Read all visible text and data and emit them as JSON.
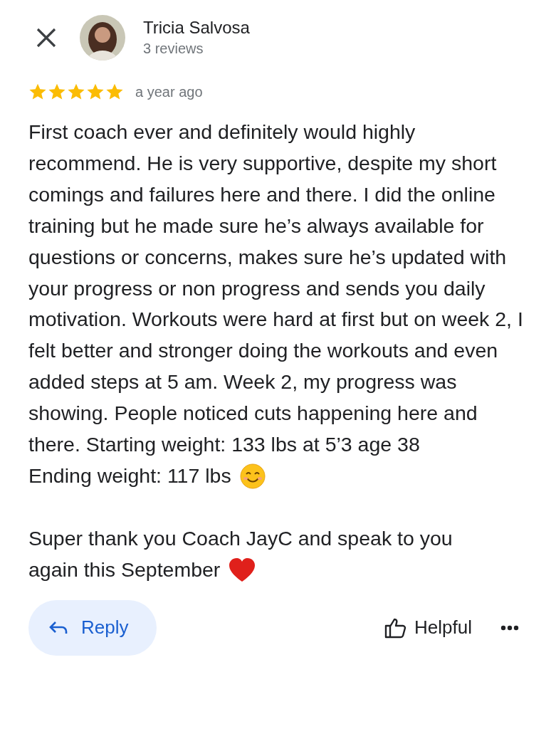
{
  "reviewer": {
    "name": "Tricia Salvosa",
    "reviews": "3 reviews"
  },
  "rating": {
    "stars": 5,
    "time": "a year ago"
  },
  "body": [
    {
      "lines": [
        {
          "text": "First coach ever and definitely would highly recommend. He is very supportive, despite my short comings and failures here and there. I did the online training but he made sure he’s always available for questions or concerns, makes sure he’s updated with your progress or non progress and sends you daily motivation. Workouts were hard at first but on week 2, I felt better and stronger doing the workouts and even added steps at 5 am. Week 2, my progress was showing. People noticed cuts happening here and there. Starting weight: 133 lbs at 5’3 age 38"
        },
        {
          "text": "Ending weight: 117 lbs",
          "kind": "smile"
        }
      ]
    },
    {
      "lines": [
        {
          "text": "Super thank you Coach JayC and speak to you"
        },
        {
          "text": "again this September",
          "kind": "heart"
        }
      ]
    }
  ],
  "actions": {
    "reply": "Reply",
    "helpful": "Helpful"
  }
}
